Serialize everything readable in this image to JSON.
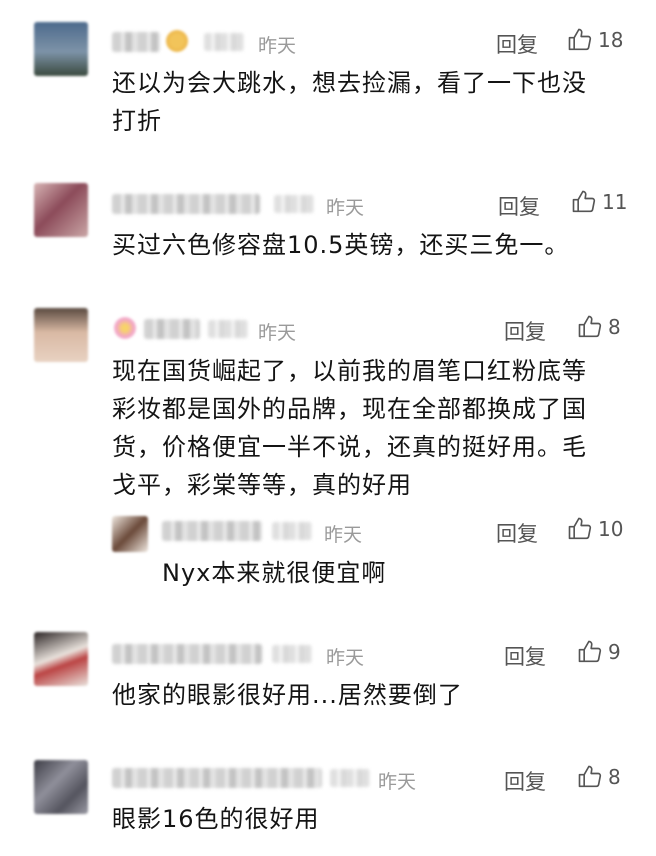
{
  "comments": [
    {
      "time": "昨天",
      "reply": "回复",
      "likes": "18",
      "text_lines": [
        "还以为会大跳水，想去捡漏，看了一下也没",
        "打折"
      ]
    },
    {
      "time": "昨天",
      "reply": "回复",
      "likes": "11",
      "text_lines": [
        "买过六色修容盘10.5英镑，还买三免一。"
      ]
    },
    {
      "time": "昨天",
      "reply": "回复",
      "likes": "8",
      "text_lines": [
        "现在国货崛起了，以前我的眉笔口红粉底等",
        "彩妆都是国外的品牌，现在全部都换成了国",
        "货，价格便宜一半不说，还真的挺好用。毛",
        "戈平，彩棠等等，真的好用"
      ]
    },
    {
      "time": "昨天",
      "reply": "回复",
      "likes": "10",
      "text_lines": [
        "Nyx本来就很便宜啊"
      ]
    },
    {
      "time": "昨天",
      "reply": "回复",
      "likes": "9",
      "text_lines": [
        "他家的眼影很好用...居然要倒了"
      ]
    },
    {
      "time": "昨天",
      "reply": "回复",
      "likes": "8",
      "text_lines": [
        "眼影16色的很好用"
      ]
    }
  ],
  "icons": {
    "like": "thumbs-up-icon"
  }
}
